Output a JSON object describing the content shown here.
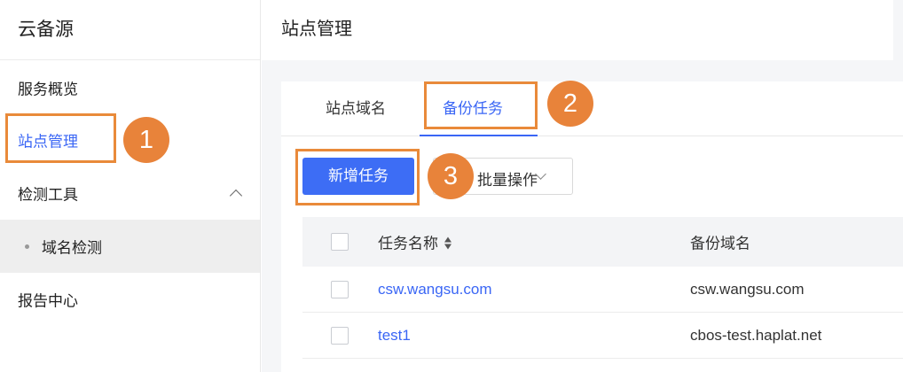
{
  "sidebar": {
    "brand": "云备源",
    "items": [
      {
        "label": "服务概览"
      },
      {
        "label": "站点管理"
      },
      {
        "label": "检测工具"
      },
      {
        "label": "域名检测"
      },
      {
        "label": "报告中心"
      }
    ]
  },
  "main": {
    "title": "站点管理",
    "tabs": [
      {
        "label": "站点域名"
      },
      {
        "label": "备份任务"
      }
    ],
    "toolbar": {
      "add_label": "新增任务",
      "bulk_label": "批量操作"
    },
    "table": {
      "headers": [
        "任务名称",
        "备份域名"
      ],
      "rows": [
        {
          "name": "csw.wangsu.com",
          "domain": "csw.wangsu.com"
        },
        {
          "name": "test1",
          "domain": "cbos-test.haplat.net"
        }
      ]
    }
  },
  "annotations": [
    "1",
    "2",
    "3"
  ],
  "colors": {
    "accent": "#3a66f5",
    "primary_button": "#3d6df5",
    "annotation": "#e8833a"
  }
}
